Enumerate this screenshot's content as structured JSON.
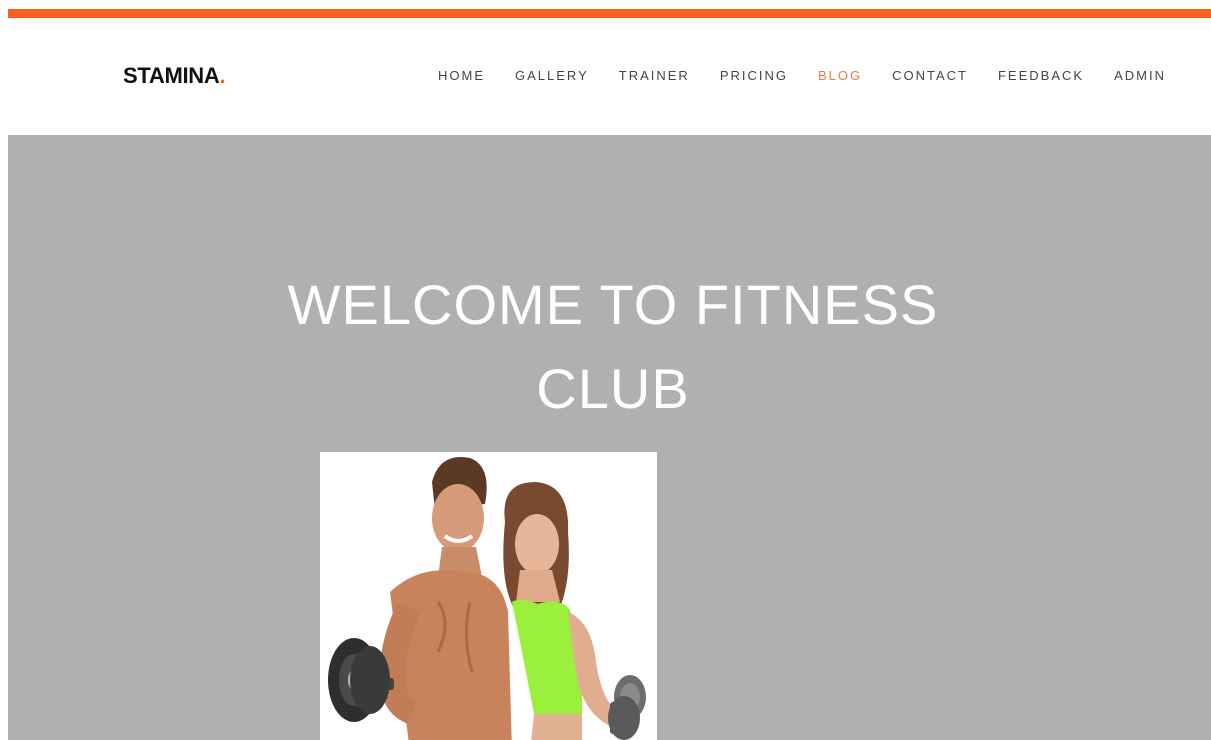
{
  "brand": {
    "name": "STAMINA",
    "dot": ".",
    "accent_color": "#f5601e"
  },
  "nav": {
    "items": [
      {
        "label": "HOME"
      },
      {
        "label": "GALLERY"
      },
      {
        "label": "TRAINER"
      },
      {
        "label": "PRICING"
      },
      {
        "label": "BLOG",
        "active": true
      },
      {
        "label": "CONTACT"
      },
      {
        "label": "FEEDBACK"
      },
      {
        "label": "ADMIN"
      }
    ],
    "active_color": "#e87b4d"
  },
  "hero": {
    "title_line1": "WELCOME TO FITNESS",
    "title_line2": "CLUB",
    "background_color": "#b0b0b0",
    "image_subject": "fitness-couple-with-dumbbells"
  }
}
